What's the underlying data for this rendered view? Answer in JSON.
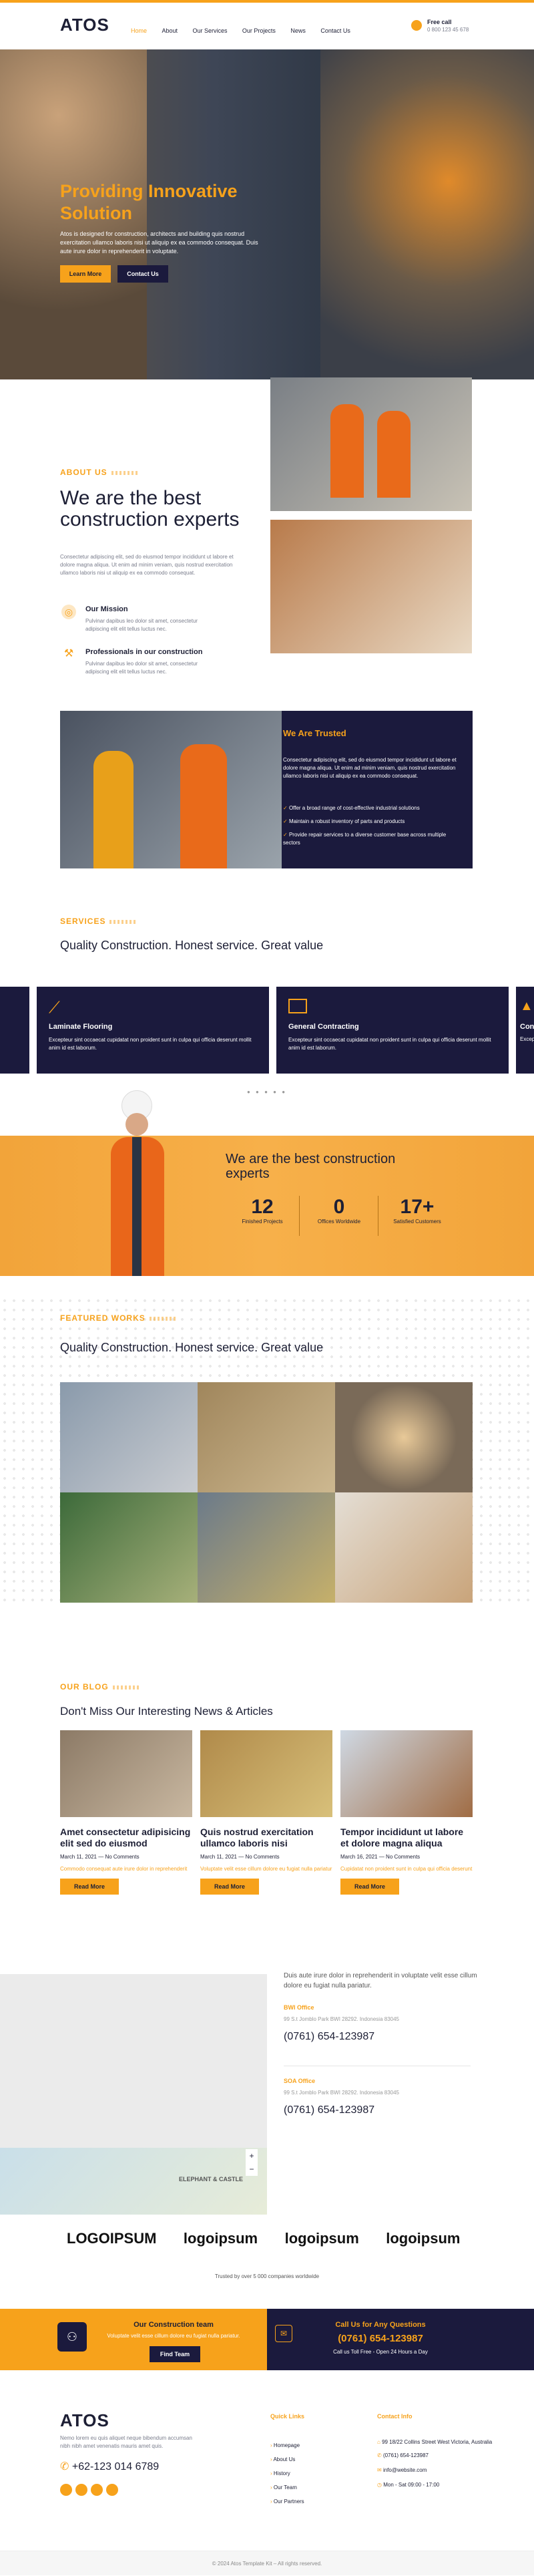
{
  "header": {
    "logo": "ATOS",
    "nav": [
      "Home",
      "About",
      "Our Services",
      "Our Projects",
      "News",
      "Contact Us"
    ],
    "call_label": "Free call",
    "phone": "0 800 123 45 678"
  },
  "hero": {
    "title": "Providing Innovative Solution",
    "text": "Atos is designed for construction, architects and building quis nostrud exercitation ullamco laboris nisi ut aliquip ex ea commodo consequat. Duis aute irure dolor in reprehenderit in voluptate.",
    "btn_learn": "Learn More",
    "btn_contact": "Contact Us"
  },
  "about": {
    "tag": "ABOUT US",
    "title": "We are the best construction experts",
    "text": "Consectetur adipiscing elit, sed do eiusmod tempor incididunt ut labore et dolore magna aliqua. Ut enim ad minim veniam, quis nostrud exercitation ullamco laboris nisi ut aliquip ex ea commodo consequat.",
    "mission_title": "Our Mission",
    "mission_text": "Pulvinar dapibus leo dolor sit amet, consectetur adipiscing elit elit tellus luctus nec.",
    "pro_title": "Professionals in our construction",
    "pro_text": "Pulvinar dapibus leo dolor sit amet, consectetur adipiscing elit elit tellus luctus nec."
  },
  "trusted": {
    "title": "We Are Trusted",
    "text": "Consectetur adipiscing elit, sed do eiusmod tempor incididunt ut labore et dolore magna aliqua. Ut enim ad minim veniam, quis nostrud exercitation ullamco laboris nisi ut aliquip ex ea commodo consequat.",
    "items": [
      "Offer a broad range of cost-effective industrial solutions",
      "Maintain a robust inventory of parts and products",
      "Provide repair services to a diverse customer base across multiple sectors"
    ]
  },
  "services": {
    "tag": "SERVICES",
    "title": "Quality Construction. Honest service. Great value",
    "cards": [
      {
        "title": "Laminate Flooring",
        "text": "Excepteur sint occaecat cupidatat non proident sunt in culpa qui officia deserunt mollit anim id est laborum."
      },
      {
        "title": "General Contracting",
        "text": "Excepteur sint occaecat cupidatat non proident sunt in culpa qui officia deserunt mollit anim id est laborum."
      },
      {
        "title": "Const",
        "text": "Excep deserun"
      }
    ]
  },
  "stats": {
    "title": "We are the best construction experts",
    "items": [
      {
        "num": "12",
        "label": "Finished Projects"
      },
      {
        "num": "0",
        "label": "Offices Worldwide"
      },
      {
        "num": "17+",
        "label": "Satisfied Customers"
      }
    ]
  },
  "works": {
    "tag": "FEATURED WORKS",
    "title": "Quality Construction. Honest service. Great value"
  },
  "blog": {
    "tag": "OUR BLOG",
    "title": "Don't Miss Our Interesting News & Articles",
    "posts": [
      {
        "title": "Amet consectetur adipisicing elit sed do eiusmod",
        "meta": "March 11, 2021 — No Comments",
        "text": "Commodo consequat aute irure dolor in reprehenderit",
        "btn": "Read More"
      },
      {
        "title": "Quis nostrud exercitation ullamco laboris nisi",
        "meta": "March 11, 2021 — No Comments",
        "text": "Voluptate velit esse cillum dolore eu fugiat nulla pariatur",
        "btn": "Read More"
      },
      {
        "title": "Tempor incididunt ut labore et dolore magna aliqua",
        "meta": "March 16, 2021 — No Comments",
        "text": "Cupidatat non proident sunt in culpa qui officia deserunt",
        "btn": "Read More"
      }
    ]
  },
  "contact": {
    "intro": "Duis aute irure dolor in reprehenderit in voluptate velit esse cillum dolore eu fugiat nulla pariatur.",
    "office1": "BWI Office",
    "addr1": "99 S.t Jomblo Park BWI 28292. Indonesia 83045",
    "phone1": "(0761) 654-123987",
    "office2": "SOA Office",
    "addr2": "99 S.t Jomblo Park BWI 28292. Indonesia 83045",
    "phone2": "(0761) 654-123987",
    "map_label": "ELEPHANT & CASTLE"
  },
  "partners": {
    "logos": [
      "LOGOIPSUM",
      "logoipsum",
      "logoipsum",
      "logoipsum"
    ],
    "trust_text": "Trusted by over 5 000 companies worldwide"
  },
  "cta": {
    "team_title": "Our Construction team",
    "team_text": "Voluptate velit esse cillum dolore eu fugiat nulla pariatur.",
    "team_btn": "Find Team",
    "call_title": "Call Us for Any Questions",
    "call_phone": "(0761) 654-123987",
    "call_sub": "Call us Toll Free - Open 24 Hours a Day"
  },
  "footer": {
    "logo": "ATOS",
    "text": "Nemo lorem eu quis aliquet neque bibendum accumsan nibh nibh amet venenatis mauris amet quis.",
    "phone": "+62-123 014 6789",
    "links_title": "Quick Links",
    "links": [
      "Homepage",
      "About Us",
      "History",
      "Our Team",
      "Our Partners"
    ],
    "contact_title": "Contact Info",
    "contact": [
      "99 18/22 Collins Street West Victoria, Australia",
      "(0761) 654-123987",
      "info@website.com",
      "Mon - Sat 09:00 - 17:00"
    ],
    "copy": "© 2024 Atos Template Kit – All rights reserved."
  }
}
